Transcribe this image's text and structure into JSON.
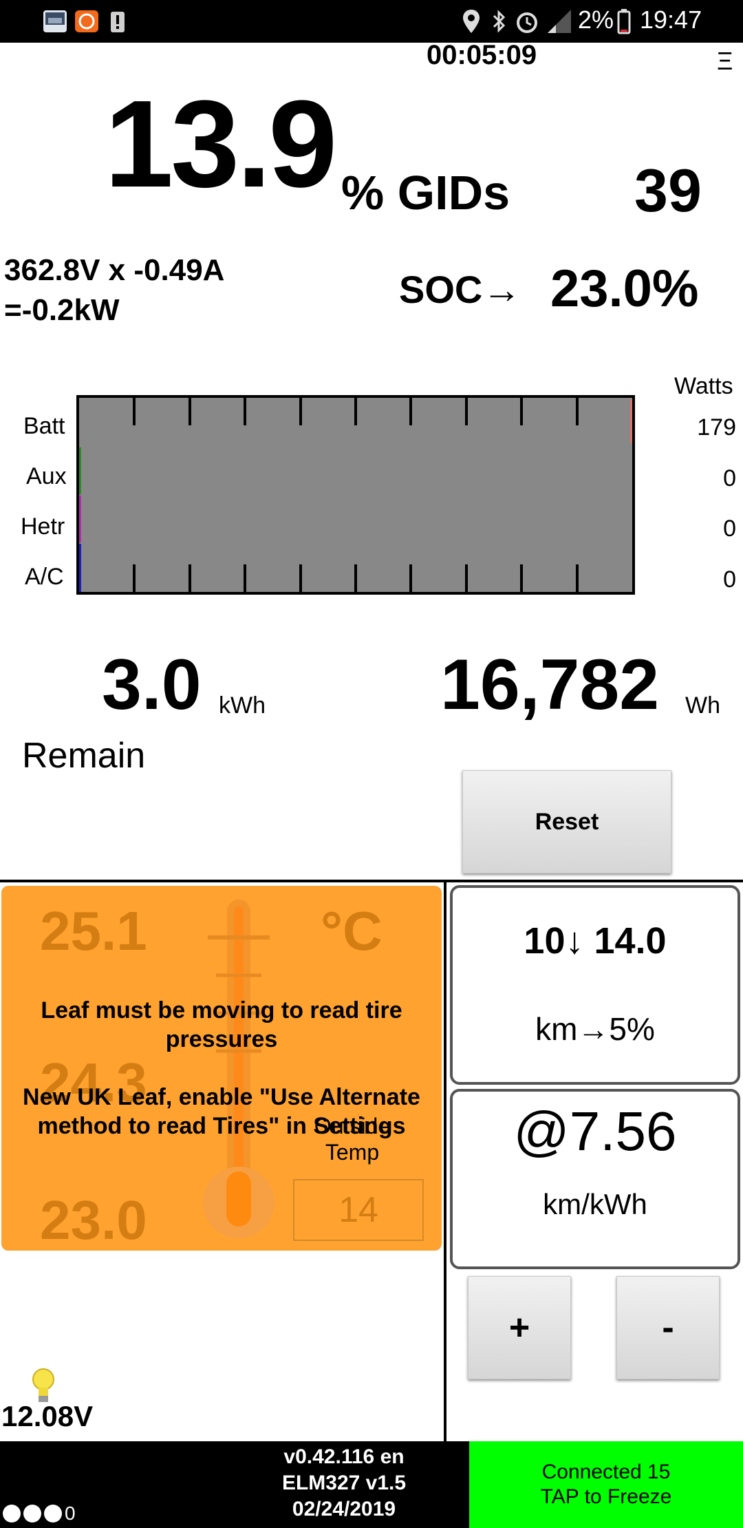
{
  "status_bar": {
    "battery_percent": "2%",
    "time": "19:47",
    "icons": [
      "gallery-icon",
      "mi-app-icon",
      "alert-icon",
      "location-icon",
      "bluetooth-icon",
      "alarm-icon",
      "signal-icon",
      "battery-icon"
    ]
  },
  "timer": "00:05:09",
  "menu_icon": "Ξ",
  "gids": {
    "percent": "13.9",
    "label": "% GIDs",
    "count": "39"
  },
  "power": {
    "line1": "362.8V x -0.49A",
    "line2": "=-0.2kW"
  },
  "soc": {
    "label": "SOC→",
    "value": "23.0%"
  },
  "gauge": {
    "unit": "Watts",
    "rows": [
      {
        "label": "Batt",
        "value": "179",
        "color": "#e07060"
      },
      {
        "label": "Aux",
        "value": "0",
        "color": "#2e8b2e"
      },
      {
        "label": "Hetr",
        "value": "0",
        "color": "#b030b0"
      },
      {
        "label": "A/C",
        "value": "0",
        "color": "#2020c0"
      }
    ]
  },
  "energy": {
    "remain_value": "3.0",
    "remain_unit": "kWh",
    "remain_label": "Remain",
    "used_value": "16,782",
    "used_unit": "Wh",
    "reset_label": "Reset"
  },
  "temps": {
    "top": "25.1",
    "unit": "°C",
    "mid": "24.3",
    "bottom": "23.0",
    "outside_label_1": "Outside",
    "outside_label_2": "Temp",
    "outside_value": "14",
    "msg1": "Leaf must be moving to read tire pressures",
    "msg2": "New UK Leaf, enable \"Use Alternate method to read Tires\" in Settings",
    "colors": {
      "panel": "#ffa22f",
      "faded_text": "#d37d12"
    }
  },
  "range": {
    "value": "10↓ 14.0",
    "unit": "km→5%"
  },
  "efficiency": {
    "value": "@7.56",
    "unit": "km/kWh"
  },
  "buttons": {
    "plus": "+",
    "minus": "-"
  },
  "aux_battery": "12.08V",
  "footer": {
    "version": "v0.42.116 en",
    "adapter": "ELM327 v1.5",
    "date": "02/24/2019",
    "dots_count": "0",
    "connected": "Connected 15",
    "tap": "TAP to Freeze",
    "connected_color": "#00ff00"
  }
}
